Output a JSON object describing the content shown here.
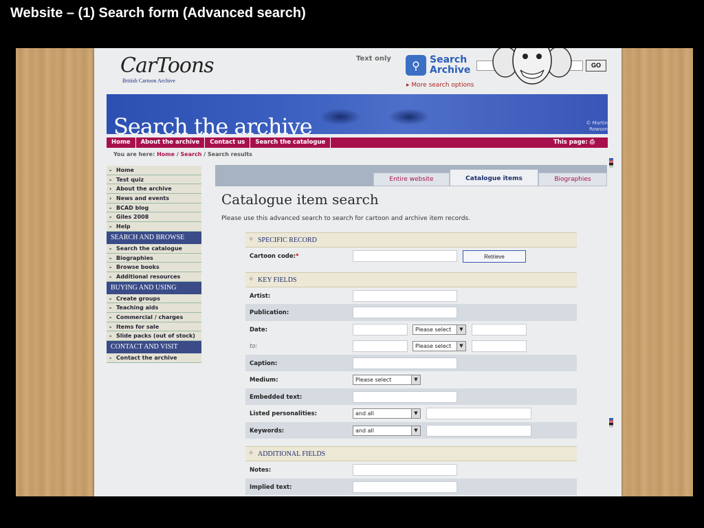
{
  "slide_title": "Website – (1) Search form (Advanced search)",
  "logo": {
    "word": "CarToons",
    "sub": "British Cartoon Archive"
  },
  "header": {
    "text_only": "Text only",
    "search_title": "Search Archive",
    "go_label": "GO",
    "more_options": "More search options"
  },
  "banner": {
    "title": "Search the archive",
    "credit": "© Martin Rowson"
  },
  "nav": {
    "items": [
      "Home",
      "About the archive",
      "Contact us",
      "Search the catalogue"
    ],
    "this_page": "This page:"
  },
  "breadcrumb": {
    "prefix": "You are here:",
    "home": "Home",
    "search": "Search",
    "current": "Search results"
  },
  "sidebar": {
    "group1": [
      {
        "mark": "-",
        "label": "Home"
      },
      {
        "mark": "-",
        "label": "Test quiz"
      },
      {
        "mark": "›",
        "label": "About the archive"
      },
      {
        "mark": "›",
        "label": "News and events"
      },
      {
        "mark": "-",
        "label": "BCAD blog"
      },
      {
        "mark": "-",
        "label": "Giles 2008"
      },
      {
        "mark": "-",
        "label": "Help"
      }
    ],
    "head2": "SEARCH AND BROWSE",
    "group2": [
      {
        "mark": "-",
        "label": "Search the catalogue"
      },
      {
        "mark": "-",
        "label": "Biographies"
      },
      {
        "mark": "-",
        "label": "Browse books"
      },
      {
        "mark": "-",
        "label": "Additional resources"
      }
    ],
    "head3": "BUYING AND USING",
    "group3": [
      {
        "mark": "-",
        "label": "Create groups"
      },
      {
        "mark": "-",
        "label": "Teaching aids"
      },
      {
        "mark": "-",
        "label": "Commercial / charges"
      },
      {
        "mark": "-",
        "label": "Items for sale"
      },
      {
        "mark": "-",
        "label": "Slide packs (out of stock)"
      }
    ],
    "head4": "CONTACT AND VISIT",
    "group4": [
      {
        "mark": "-",
        "label": "Contact the archive"
      }
    ]
  },
  "tabs": {
    "entire": "Entire website",
    "catalogue": "Catalogue items",
    "biographies": "Biographies"
  },
  "main": {
    "title": "Catalogue item search",
    "intro": "Please use this advanced search to search for cartoon and archive item records."
  },
  "form": {
    "specific_record": "SPECIFIC RECORD",
    "cartoon_code": "Cartoon code:",
    "required_mark": "*",
    "retrieve": "Retrieve",
    "key_fields": "KEY FIELDS",
    "artist": "Artist:",
    "publication": "Publication:",
    "date": "Date:",
    "to": "to:",
    "please_select": "Please select",
    "caption": "Caption:",
    "medium": "Medium:",
    "embedded_text": "Embedded text:",
    "listed_personalities": "Listed personalities:",
    "and_all": "and all",
    "keywords": "Keywords:",
    "additional_fields": "ADDITIONAL FIELDS",
    "notes": "Notes:",
    "implied_text": "Implied text:"
  }
}
